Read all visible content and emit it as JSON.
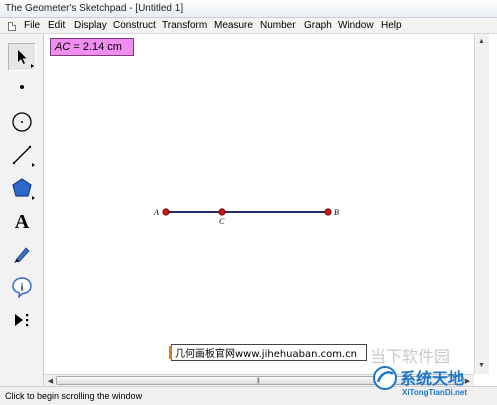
{
  "window": {
    "title": "The Geometer's Sketchpad - [Untitled 1]"
  },
  "menu": {
    "items": [
      "File",
      "Edit",
      "Display",
      "Construct",
      "Transform",
      "Measure",
      "Number",
      "Graph",
      "Window",
      "Help"
    ]
  },
  "toolbox": {
    "tools": [
      "arrow-select-icon",
      "point-icon",
      "compass-icon",
      "straightedge-icon",
      "polygon-icon",
      "text-icon",
      "marker-icon",
      "information-icon",
      "custom-tool-icon"
    ]
  },
  "sketch": {
    "measurement": {
      "segment": "AC",
      "equals": " = ",
      "value": "2.14 cm"
    },
    "points": [
      "A",
      "C",
      "B"
    ],
    "colors": {
      "segment": "#2a2a6e",
      "point": "#c41a1a",
      "measurement_bg": "#f08ef0"
    }
  },
  "status": {
    "text": "Click to begin scrolling the window"
  },
  "watermarks": {
    "left": "几何画板官网www.jihehuaban.com.cn",
    "right_top": "当下软件园",
    "right_brand": "系统天地",
    "right_url": "XiTongTianDi.net"
  }
}
